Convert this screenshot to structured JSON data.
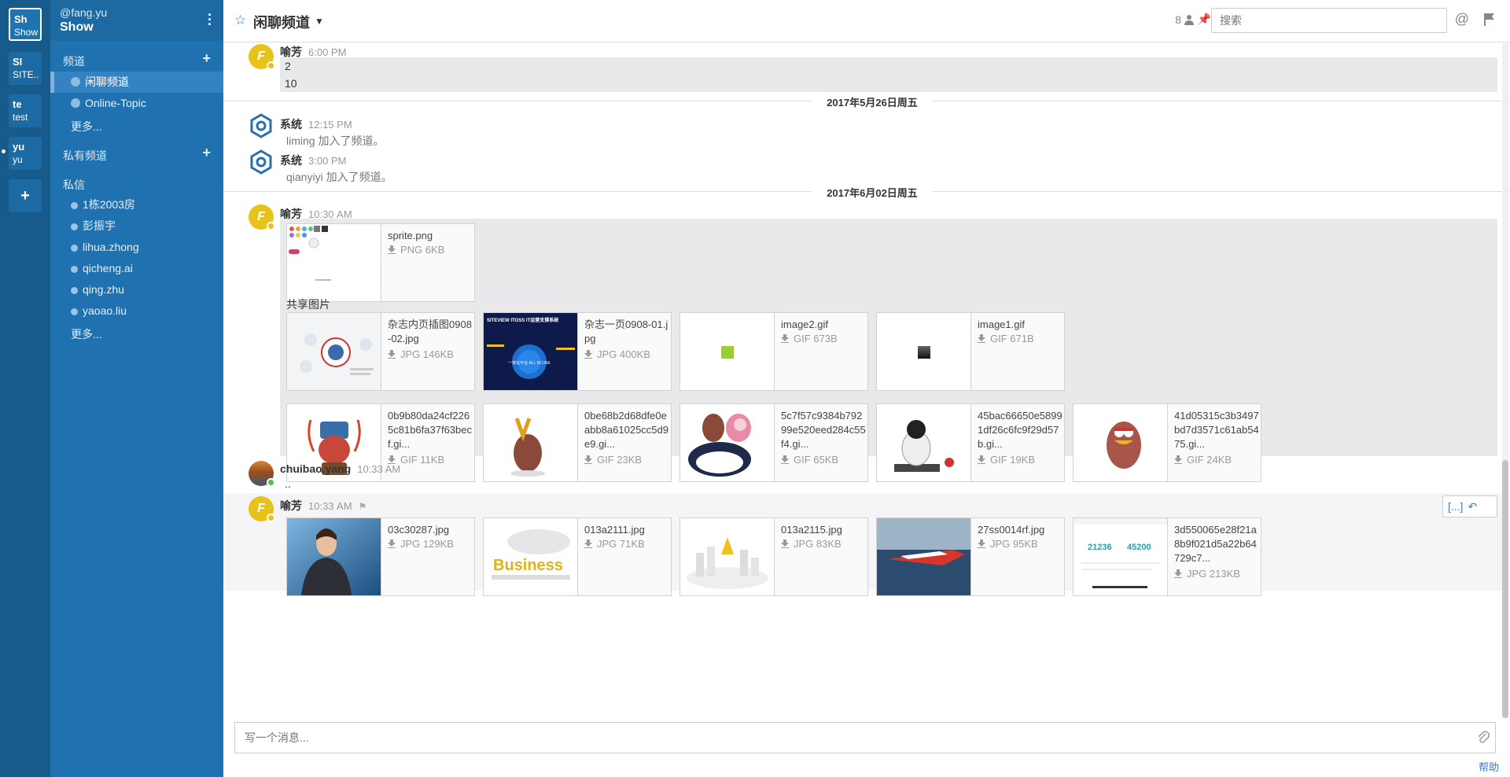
{
  "teams": [
    {
      "abbr": "Sh",
      "name": "Show"
    },
    {
      "abbr": "SI",
      "name": "SITE..."
    },
    {
      "abbr": "te",
      "name": "test"
    },
    {
      "abbr": "yu",
      "name": "yu"
    }
  ],
  "team_add": "+",
  "sidebar": {
    "username": "@fang.yu",
    "team_name": "Show",
    "channels_header": "频道",
    "channels": [
      "闲聊频道",
      "Online-Topic"
    ],
    "channels_more": "更多...",
    "private_header": "私有频道",
    "dm_header": "私信",
    "dms": [
      "1栋2003房",
      "彭振宇",
      "lihua.zhong",
      "qicheng.ai",
      "qing.zhu",
      "yaoao.liu"
    ],
    "dm_more": "更多...",
    "add": "+"
  },
  "header": {
    "channel": "闲聊频道",
    "member_count": "8",
    "search_placeholder": "搜索"
  },
  "messages": {
    "m1": {
      "sender": "喻芳",
      "time": "6:00 PM",
      "lines": [
        "2",
        "10"
      ]
    },
    "sep1": "2017年5月26日周五",
    "s1": {
      "sender": "系统",
      "time": "12:15 PM",
      "text": "liming 加入了频道。"
    },
    "s2": {
      "sender": "系统",
      "time": "3:00 PM",
      "text": "qianyiyi 加入了频道。"
    },
    "sep2": "2017年6月02日周五",
    "m2": {
      "sender": "喻芳",
      "time": "10:30 AM",
      "file": {
        "name": "sprite.png",
        "meta": "PNG 6KB"
      },
      "shared_title": "共享图片",
      "row1": [
        {
          "name": "杂志内页插图0908-02.jpg",
          "meta": "JPG 146KB"
        },
        {
          "name": "杂志一页0908-01.jpg",
          "meta": "JPG 400KB"
        },
        {
          "name": "image2.gif",
          "meta": "GIF 673B"
        },
        {
          "name": "image1.gif",
          "meta": "GIF 671B"
        }
      ],
      "row2": [
        {
          "name": "0b9b80da24cf2265c81b6fa37f63becf.gi...",
          "meta": "GIF 11KB"
        },
        {
          "name": "0be68b2d68dfe0eabb8a61025cc5d9e9.gi...",
          "meta": "GIF 23KB"
        },
        {
          "name": "5c7f57c9384b79299e520eed284c55f4.gi...",
          "meta": "GIF 65KB"
        },
        {
          "name": "45bac66650e58991df26c6fc9f29d57b.gi...",
          "meta": "GIF 19KB"
        },
        {
          "name": "41d05315c3b3497bd7d3571c61ab5475.gi...",
          "meta": "GIF 24KB"
        }
      ]
    },
    "m3": {
      "sender": "chuibao.yang",
      "time": "10:33 AM",
      "text": ".."
    },
    "m4": {
      "sender": "喻芳",
      "time": "10:33 AM",
      "actions": "[...]",
      "row": [
        {
          "name": "03c30287.jpg",
          "meta": "JPG 129KB"
        },
        {
          "name": "013a2111.jpg",
          "meta": "JPG 71KB"
        },
        {
          "name": "013a2115.jpg",
          "meta": "JPG 83KB"
        },
        {
          "name": "27ss0014rf.jpg",
          "meta": "JPG 95KB"
        },
        {
          "name": "3d550065e28f21a8b9f021d5a22b64729c7...",
          "meta": "JPG 213KB"
        }
      ]
    }
  },
  "thumb_text": {
    "siteview_title": "SITEVIEW ITOSS IT运营支撑系统",
    "siteview_badge": "一体化平台 ALL IN ONE",
    "business": "Business",
    "stat_a": "21236",
    "stat_b": "45200"
  },
  "composer_placeholder": "写一个消息...",
  "help": "帮助",
  "colors": {
    "team_bar": "#175b8c",
    "sidebar": "#2071b0",
    "accent": "#4078c0",
    "avatar_f": "#e6c21a"
  }
}
